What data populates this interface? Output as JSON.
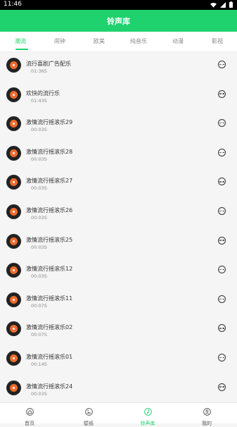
{
  "status_bar": {
    "time": "11:46"
  },
  "header": {
    "title": "铃声库"
  },
  "tabs": [
    {
      "label": "潮流",
      "active": true
    },
    {
      "label": "闹钟",
      "active": false
    },
    {
      "label": "欧美",
      "active": false
    },
    {
      "label": "纯音乐",
      "active": false
    },
    {
      "label": "动漫",
      "active": false
    },
    {
      "label": "影视",
      "active": false
    }
  ],
  "songs": [
    {
      "title": "流行喜剧广告配乐",
      "duration": "01:36S"
    },
    {
      "title": "欢快的流行乐",
      "duration": "01:43S"
    },
    {
      "title": "激情流行摇滚乐29",
      "duration": "00:03S"
    },
    {
      "title": "激情流行摇滚乐28",
      "duration": "00:03S"
    },
    {
      "title": "激情流行摇滚乐27",
      "duration": "00:03S"
    },
    {
      "title": "激情流行摇滚乐26",
      "duration": "00:03S"
    },
    {
      "title": "激情流行摇滚乐25",
      "duration": "00:03S"
    },
    {
      "title": "激情流行摇滚乐12",
      "duration": "00:03S"
    },
    {
      "title": "激情流行摇滚乐11",
      "duration": "00:07S"
    },
    {
      "title": "激情流行摇滚乐02",
      "duration": "00:07S"
    },
    {
      "title": "激情流行摇滚乐01",
      "duration": "00:14S"
    },
    {
      "title": "激情流行摇滚乐24",
      "duration": "00:03S"
    }
  ],
  "bottom_nav": [
    {
      "label": "首页",
      "icon": "home-icon",
      "active": false
    },
    {
      "label": "壁纸",
      "icon": "image-icon",
      "active": false
    },
    {
      "label": "铃声库",
      "icon": "music-note-icon",
      "active": true
    },
    {
      "label": "我的",
      "icon": "user-icon",
      "active": false
    }
  ],
  "colors": {
    "accent": "#20d26e",
    "disc": "#222222",
    "disc_label": "#f26b2a"
  }
}
